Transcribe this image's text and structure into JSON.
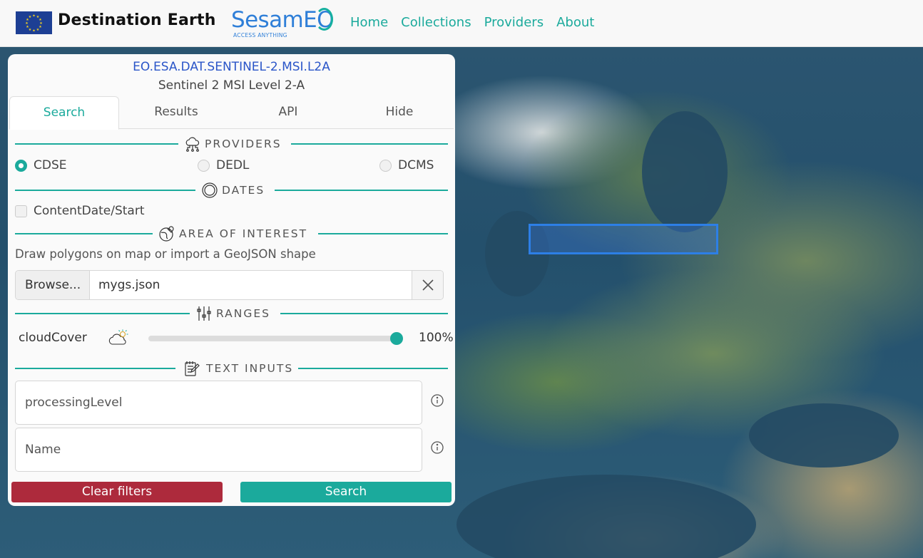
{
  "header": {
    "brand_title": "Destination Earth",
    "sesam_name": "SesamEO",
    "sesam_tagline": "ACCESS ANYTHING",
    "nav": [
      "Home",
      "Collections",
      "Providers",
      "About"
    ]
  },
  "collection": {
    "id": "EO.ESA.DAT.SENTINEL-2.MSI.L2A",
    "name": "Sentinel 2 MSI Level 2-A"
  },
  "tabs": [
    {
      "label": "Search",
      "active": true
    },
    {
      "label": "Results",
      "active": false
    },
    {
      "label": "API",
      "active": false
    },
    {
      "label": "Hide",
      "active": false
    }
  ],
  "sections": {
    "providers": "PROVIDERS",
    "dates": "DATES",
    "aoi": "AREA OF INTEREST",
    "ranges": "RANGES",
    "text_inputs": "TEXT INPUTS"
  },
  "providers": [
    {
      "label": "CDSE",
      "selected": true
    },
    {
      "label": "DEDL",
      "selected": false
    },
    {
      "label": "DCMS",
      "selected": false
    }
  ],
  "dates": {
    "checkbox_label": "ContentDate/Start",
    "checked": false
  },
  "aoi": {
    "hint": "Draw polygons on map or import a GeoJSON shape",
    "browse_label": "Browse...",
    "file_name": "mygs.json"
  },
  "ranges": {
    "label": "cloudCover",
    "value": 100,
    "value_label": "100%",
    "icon": "cloud-sun-icon"
  },
  "text_inputs": [
    {
      "placeholder": "processingLevel"
    },
    {
      "placeholder": "Name"
    }
  ],
  "buttons": {
    "clear": "Clear filters",
    "search": "Search"
  },
  "colors": {
    "accent": "#1baa9c",
    "danger": "#ad2a3c",
    "link_blue": "#2a55c8",
    "aoi_blue": "#2d7fe6"
  }
}
